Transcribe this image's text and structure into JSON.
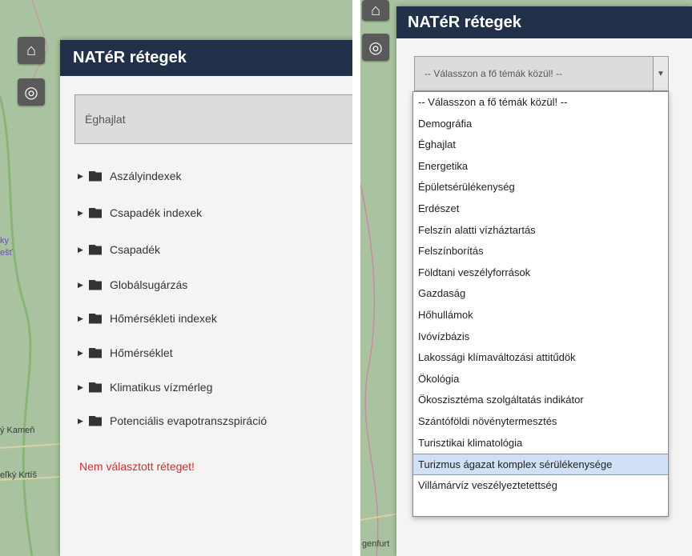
{
  "left": {
    "panel_title": "NATéR rétegek",
    "select_value": "Éghajlat",
    "layers": [
      {
        "label": "Aszályindexek"
      },
      {
        "label": "Csapadék indexek"
      },
      {
        "label": "Csapadék"
      },
      {
        "label": "Globálsugárzás"
      },
      {
        "label": "Hőmérsékleti indexek"
      },
      {
        "label": "Hőmérséklet"
      },
      {
        "label": "Klimatikus vízmérleg"
      },
      {
        "label": "Potenciális evapotranszspiráció"
      }
    ],
    "status": "Nem választott réteget!",
    "map_labels": [
      "ky",
      "ešť",
      "ý Kameň",
      "eľký Krtíš"
    ]
  },
  "right": {
    "panel_title": "NATéR rétegek",
    "select_value": "-- Válasszon a fő témák közül! --",
    "options": [
      "-- Válasszon a fő témák közül! --",
      "Demográfia",
      "Éghajlat",
      "Energetika",
      "Épületsérülékenység",
      "Erdészet",
      "Felszín alatti vízháztartás",
      "Felszínborítás",
      "Földtani veszélyforrások",
      "Gazdaság",
      "Hőhullámok",
      "Ivóvízbázis",
      "Lakossági klímaváltozási attitűdök",
      "Ökológia",
      "Ökoszisztéma szolgáltatás indikátor",
      "Szántóföldi növénytermesztés",
      "Turisztikai klimatológia",
      "Turizmus ágazat komplex sérülékenysége",
      "Villámárvíz veszélyeztetettség"
    ],
    "highlighted_option": "Turizmus ágazat komplex sérülékenysége",
    "map_labels": [
      "genfurt"
    ]
  },
  "icons": {
    "home": "home-icon",
    "locate": "crosshair-icon",
    "dropdown": "chevron-down-icon",
    "folder": "folder-icon",
    "caret": "caret-right-icon"
  },
  "colors": {
    "header_bg": "#22304a",
    "status_text": "#e0262a",
    "highlight_bg": "#cfe0f7"
  }
}
